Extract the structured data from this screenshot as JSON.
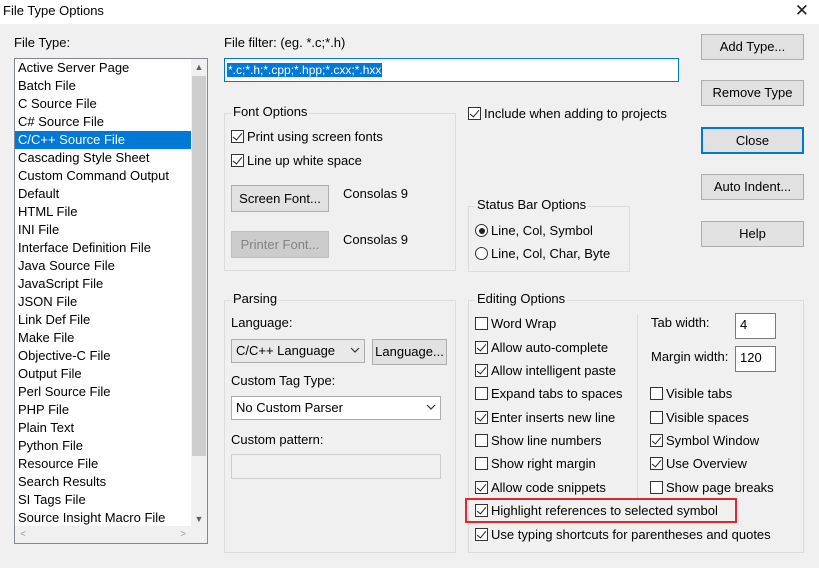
{
  "window": {
    "title": "File Type Options",
    "close_glyph": "✕"
  },
  "file_type": {
    "label": "File Type:",
    "items": [
      "Active Server Page",
      "Batch File",
      "C Source File",
      "C# Source File",
      "C/C++ Source File",
      "Cascading Style Sheet",
      "Custom Command Output",
      "Default",
      "HTML File",
      "INI File",
      "Interface Definition File",
      "Java Source File",
      "JavaScript File",
      "JSON File",
      "Link Def File",
      "Make File",
      "Objective-C File",
      "Output File",
      "Perl Source File",
      "PHP File",
      "Plain Text",
      "Python File",
      "Resource File",
      "Search Results",
      "SI Tags File",
      "Source Insight Macro File"
    ],
    "selected_index": 4
  },
  "file_filter": {
    "label": "File filter: (eg. *.c;*.h)",
    "value": "*.c;*.h;*.cpp;*.hpp;*.cxx;*.hxx"
  },
  "buttons": {
    "add_type": "Add Type...",
    "remove_type": "Remove Type",
    "close": "Close",
    "auto_indent": "Auto Indent...",
    "help": "Help"
  },
  "font_options": {
    "title": "Font Options",
    "print_screen_fonts": "Print using screen fonts",
    "line_up_white_space": "Line up white space",
    "screen_font_button": "Screen Font...",
    "screen_font_value": "Consolas 9",
    "printer_font_button": "Printer Font...",
    "printer_font_value": "Consolas 9"
  },
  "include_projects": "Include when adding to projects",
  "status_bar": {
    "title": "Status Bar Options",
    "option1": "Line, Col, Symbol",
    "option2": "Line, Col, Char, Byte",
    "selected": 1
  },
  "parsing": {
    "title": "Parsing",
    "language_label": "Language:",
    "language_value": "C/C++ Language",
    "language_button": "Language...",
    "custom_tag_label": "Custom Tag Type:",
    "custom_tag_value": "No Custom Parser",
    "custom_pattern_label": "Custom pattern:",
    "custom_pattern_value": ""
  },
  "editing": {
    "title": "Editing Options",
    "left": [
      {
        "label": "Word Wrap",
        "checked": false
      },
      {
        "label": "Allow auto-complete",
        "checked": true
      },
      {
        "label": "Allow intelligent paste",
        "checked": true
      },
      {
        "label": "Expand tabs to spaces",
        "checked": false
      },
      {
        "label": "Enter inserts new line",
        "checked": true
      },
      {
        "label": "Show line numbers",
        "checked": false
      },
      {
        "label": "Show right margin",
        "checked": false
      },
      {
        "label": "Allow code snippets",
        "checked": true
      }
    ],
    "tab_width_label": "Tab width:",
    "tab_width_value": "4",
    "margin_width_label": "Margin width:",
    "margin_width_value": "120",
    "right": [
      {
        "label": "Visible tabs",
        "checked": false
      },
      {
        "label": "Visible spaces",
        "checked": false
      },
      {
        "label": "Symbol Window",
        "checked": true
      },
      {
        "label": "Use Overview",
        "checked": true
      },
      {
        "label": "Show page breaks",
        "checked": false
      }
    ],
    "highlight_refs": {
      "label": "Highlight references to selected symbol",
      "checked": true
    },
    "typing_shortcuts": {
      "label": "Use typing shortcuts for parentheses and quotes",
      "checked": true
    }
  },
  "colors": {
    "accent": "#0078d7",
    "annotation": "#e0262f"
  }
}
